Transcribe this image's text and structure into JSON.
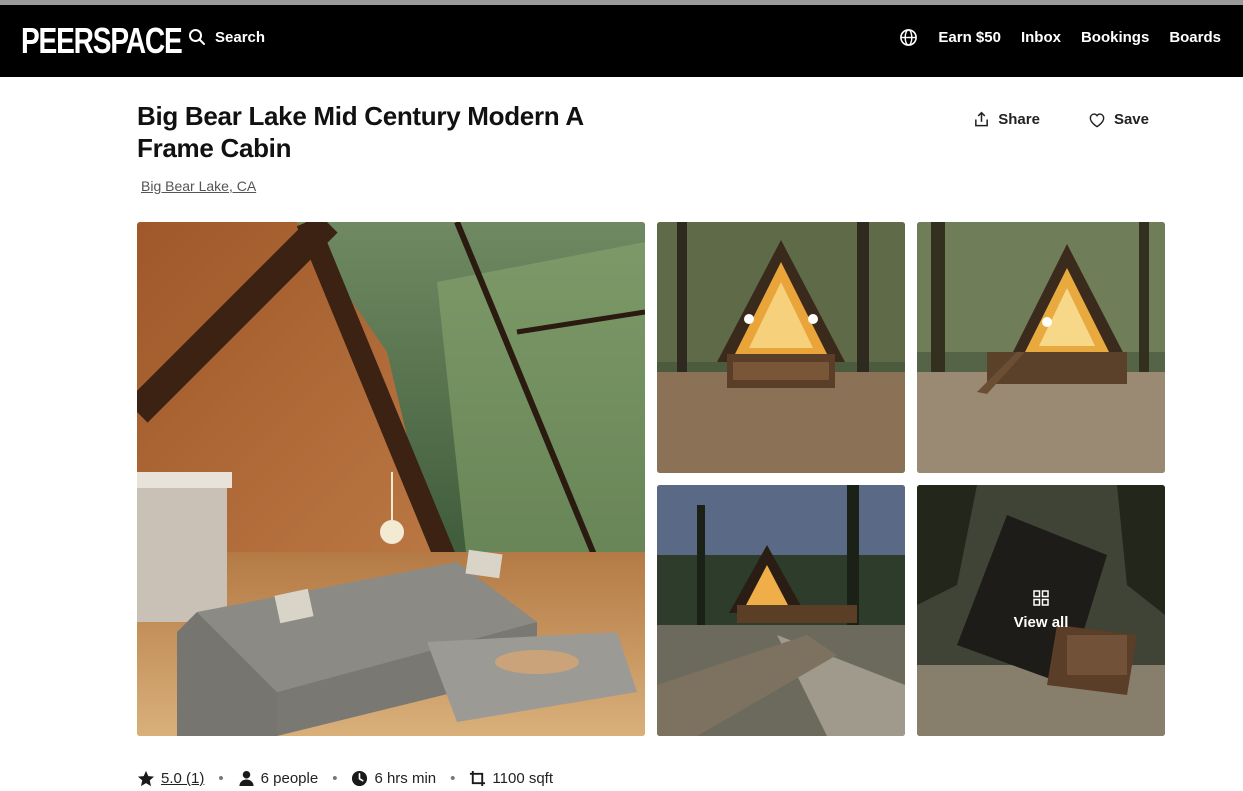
{
  "colors": {
    "navbar": "#000000",
    "accent": "#ffffff",
    "text": "#1a1a1a"
  },
  "navbar": {
    "logo": "PEERSPACE",
    "search_label": "Search",
    "links": [
      "Earn $50",
      "Inbox",
      "Bookings",
      "Boards"
    ],
    "icons": [
      "search-icon",
      "globe-icon"
    ]
  },
  "listing": {
    "title": "Big Bear Lake Mid Century Modern A Frame Cabin",
    "location": "Big Bear Lake, CA",
    "share_label": "Share",
    "save_label": "Save"
  },
  "gallery": {
    "view_all_label": "View all",
    "photos": [
      "cabin-living-room",
      "cabin-exterior-dusk",
      "cabin-exterior-evening",
      "cabin-driveway-night",
      "cabin-aerial-view"
    ]
  },
  "stats": {
    "rating": "5.0 (1)",
    "capacity": "6 people",
    "min_hours": "6 hrs min",
    "area": "1100 sqft"
  }
}
